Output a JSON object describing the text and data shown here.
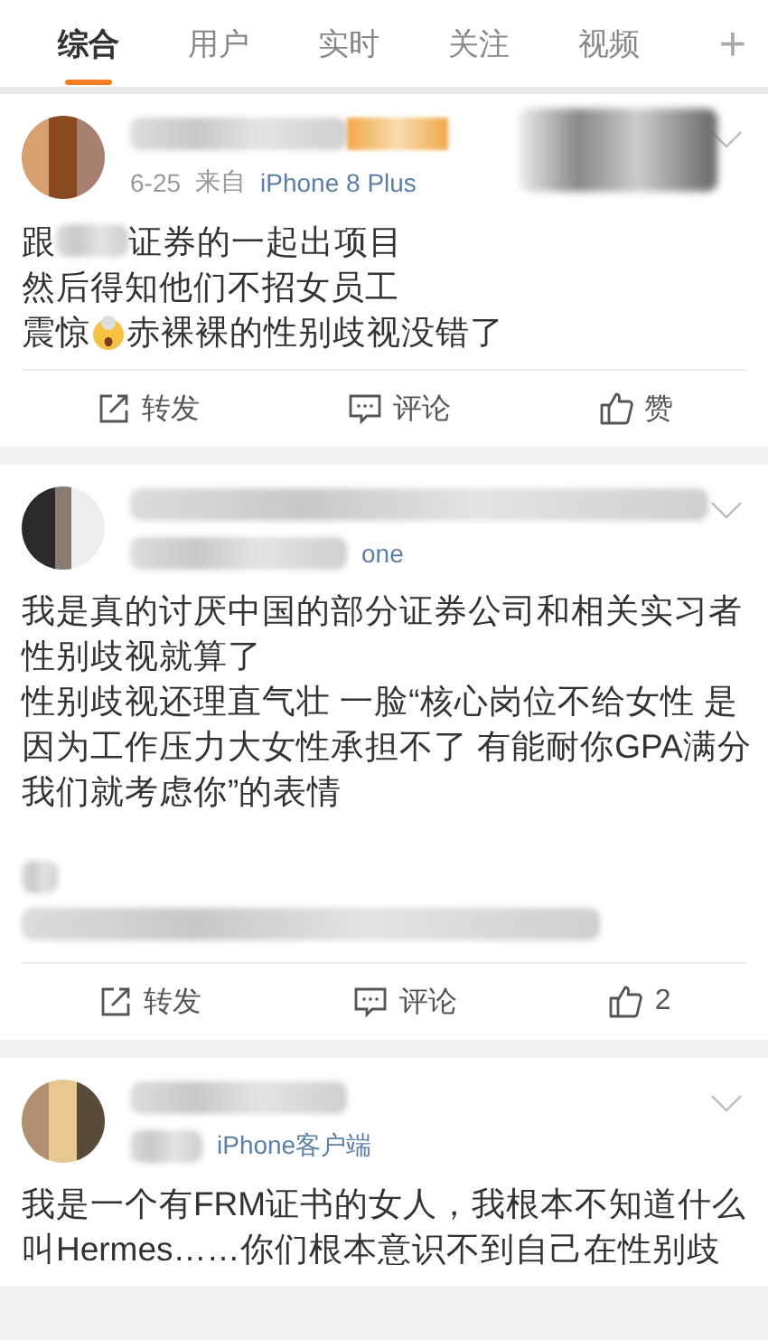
{
  "tabs": [
    {
      "label": "综合",
      "selected": true
    },
    {
      "label": "用户",
      "selected": false
    },
    {
      "label": "实时",
      "selected": false
    },
    {
      "label": "关注",
      "selected": false
    },
    {
      "label": "视频",
      "selected": false
    }
  ],
  "add_button": "+",
  "posts": [
    {
      "name": [
        {
          "kind": "blur_medium"
        },
        {
          "kind": "badge"
        },
        {
          "kind": "corner_blur"
        }
      ],
      "meta": [
        {
          "kind": "date",
          "text": "6-25"
        },
        {
          "kind": "plain",
          "text": "来自"
        },
        {
          "kind": "link",
          "text": "iPhone 8 Plus"
        }
      ],
      "body": [
        [
          {
            "kind": "text",
            "text": "跟"
          },
          {
            "kind": "blur_small"
          },
          {
            "kind": "text",
            "text": "证券的一起出项目"
          }
        ],
        [
          {
            "kind": "text",
            "text": "然后得知他们不招女员工"
          }
        ],
        [
          {
            "kind": "text",
            "text": "震惊"
          },
          {
            "kind": "emoji"
          },
          {
            "kind": "text",
            "text": "赤裸裸的性别歧视没错了"
          }
        ]
      ],
      "actions": [
        {
          "kind": "repost",
          "label": "转发"
        },
        {
          "kind": "comment",
          "label": "评论"
        },
        {
          "kind": "like",
          "label": "赞"
        }
      ]
    },
    {
      "name": [
        {
          "kind": "blur_large"
        }
      ],
      "meta": [
        {
          "kind": "blur_medium"
        },
        {
          "kind": "link",
          "text": "one"
        }
      ],
      "body": [
        [
          {
            "kind": "text",
            "text": "我是真的讨厌中国的部分证券公司和相关实习者"
          }
        ],
        [
          {
            "kind": "text",
            "text": "性别歧视就算了"
          }
        ],
        [
          {
            "kind": "text",
            "text": "性别歧视还理直气壮 一脸“核心岗位不给女性 是因为工作压力大女性承担不了 有能耐你GPA满分我们就考虑你”的表情"
          }
        ],
        [
          {
            "kind": "gap"
          }
        ],
        [
          {
            "kind": "blur_tiny"
          }
        ],
        [
          {
            "kind": "blur_large"
          }
        ]
      ],
      "actions": [
        {
          "kind": "repost",
          "label": "转发"
        },
        {
          "kind": "comment",
          "label": "评论"
        },
        {
          "kind": "like",
          "label": "2"
        }
      ]
    },
    {
      "name": [
        {
          "kind": "blur_medium"
        }
      ],
      "meta": [
        {
          "kind": "blur_small"
        },
        {
          "kind": "link",
          "text": "iPhone客户端"
        }
      ],
      "body": [
        [
          {
            "kind": "text",
            "text": "我是一个有FRM证书的女人，我根本不知道什么叫Hermes……你们根本意识不到自己在性别歧"
          }
        ]
      ]
    }
  ]
}
